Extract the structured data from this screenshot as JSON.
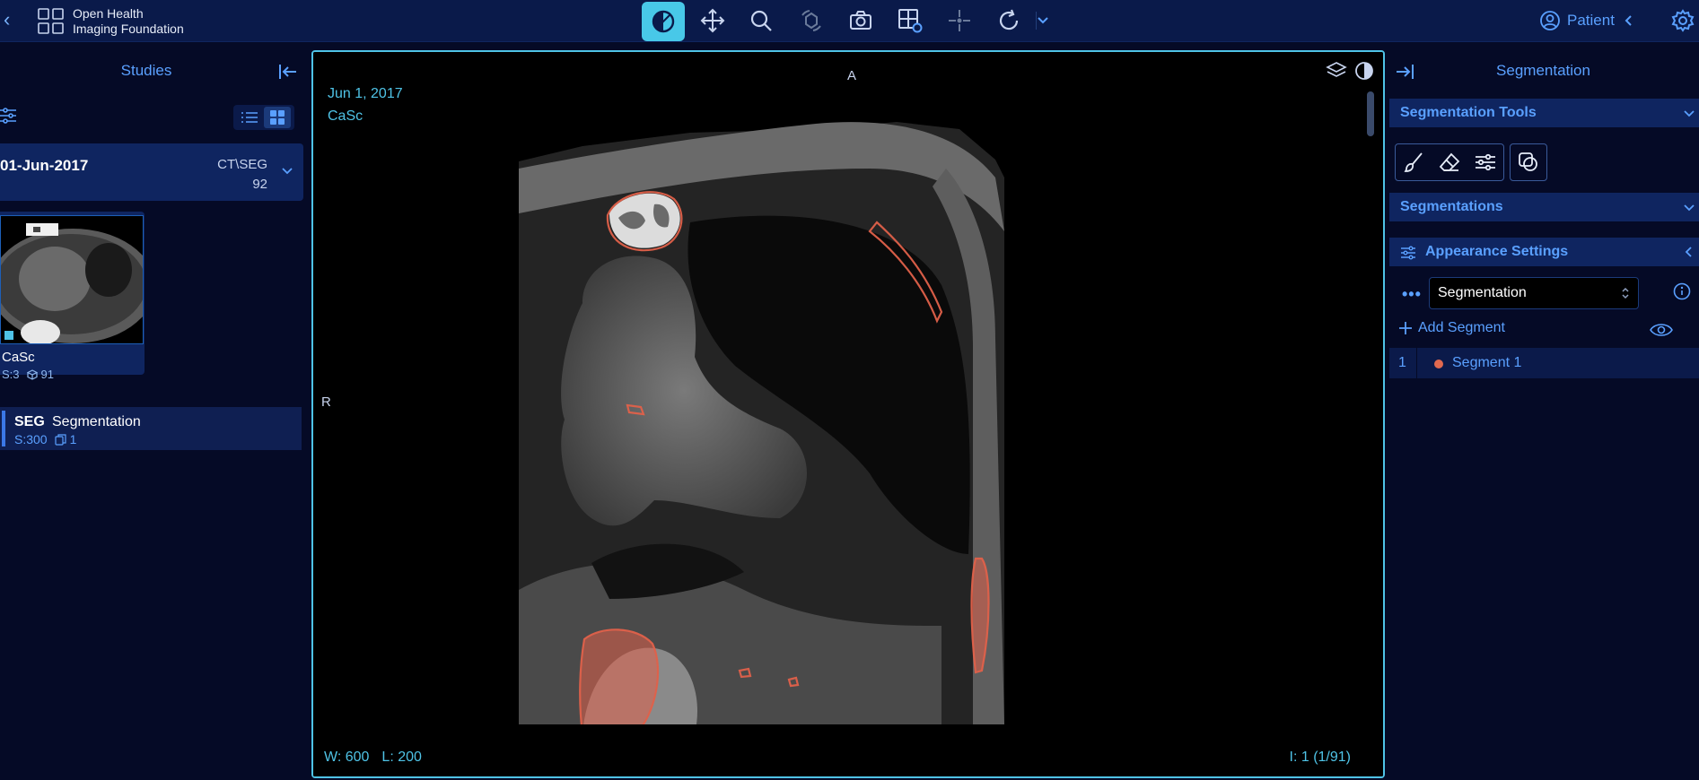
{
  "header": {
    "logo_line1": "Open Health",
    "logo_line2": "Imaging Foundation",
    "patient_label": "Patient",
    "tools": [
      "window-level",
      "pan",
      "zoom",
      "rotate",
      "capture",
      "layout",
      "crosshairs",
      "reset",
      "more"
    ]
  },
  "left_panel": {
    "title": "Studies",
    "study": {
      "date": "01-Jun-2017",
      "modalities": "CT\\SEG",
      "instances": "92"
    },
    "thumbnail": {
      "description": "CaSc",
      "series": "S:3",
      "instances": "91"
    },
    "seg_item": {
      "modality": "SEG",
      "description": "Segmentation",
      "series": "S:300",
      "instances": "1"
    }
  },
  "viewport": {
    "study_date": "Jun 1, 2017",
    "series": "CaSc",
    "orientation_top": "A",
    "orientation_left": "R",
    "w_label": "W:",
    "window_width": "600",
    "l_label": "L:",
    "window_level": "200",
    "instance": "I: 1 (1/91)"
  },
  "right_panel": {
    "title": "Segmentation",
    "tools_section": "Segmentation Tools",
    "segmentations_section": "Segmentations",
    "appearance_section": "Appearance Settings",
    "selected_segmentation": "Segmentation",
    "add_segment": "Add Segment",
    "segments": [
      {
        "index": "1",
        "label": "Segment 1",
        "color": "#e1694f"
      }
    ]
  },
  "colors": {
    "accent": "#4fc3e6",
    "primary": "#5aa0ff",
    "panel": "#0f2560",
    "background": "#050a26"
  }
}
